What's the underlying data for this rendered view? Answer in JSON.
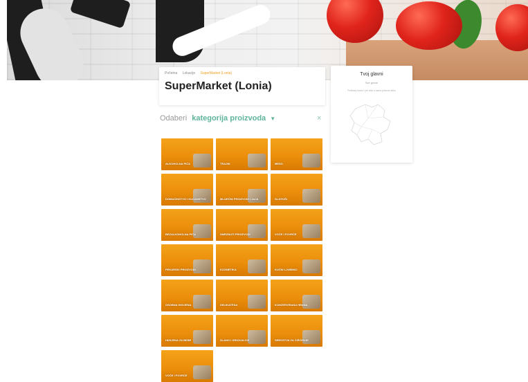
{
  "breadcrumb": [
    "Početna",
    "Lokacije",
    "SuperMarket (Lonia)"
  ],
  "page_title": "SuperMarket (Lonia)",
  "map": {
    "title": "Tvoj glavni",
    "subtitle": "Sve grane",
    "note": "Prelistaj hrane i još više u samo jednom kliku"
  },
  "selector": {
    "label": "Odaberi",
    "category": "kategorija proizvoda",
    "caret_icon": "chevron-down-icon",
    "close_icon": "close-icon"
  },
  "categories": [
    "Alkoholna pića",
    "Trajni",
    "Meso",
    "Domaćinstvo i kućanstvo",
    "Mliječni proizvodi i jaja",
    "Slatkiši",
    "Bezalkoholna pića",
    "Smrznuti proizvodi",
    "Voće i povrće",
    "Pekarski proizvodi",
    "Kozmetika",
    "Kućni ljubimci",
    "Osobna higijena",
    "Delikatesa",
    "Konzervirana hrana",
    "Higijena za bebe",
    "Slano i grickalice",
    "Sredstva za čišćenje",
    "Voće i povrće"
  ],
  "colors": {
    "tile_orange": "#ec8f0c",
    "accent_green": "#5fb49c",
    "breadcrumb_active": "#f0a020"
  }
}
